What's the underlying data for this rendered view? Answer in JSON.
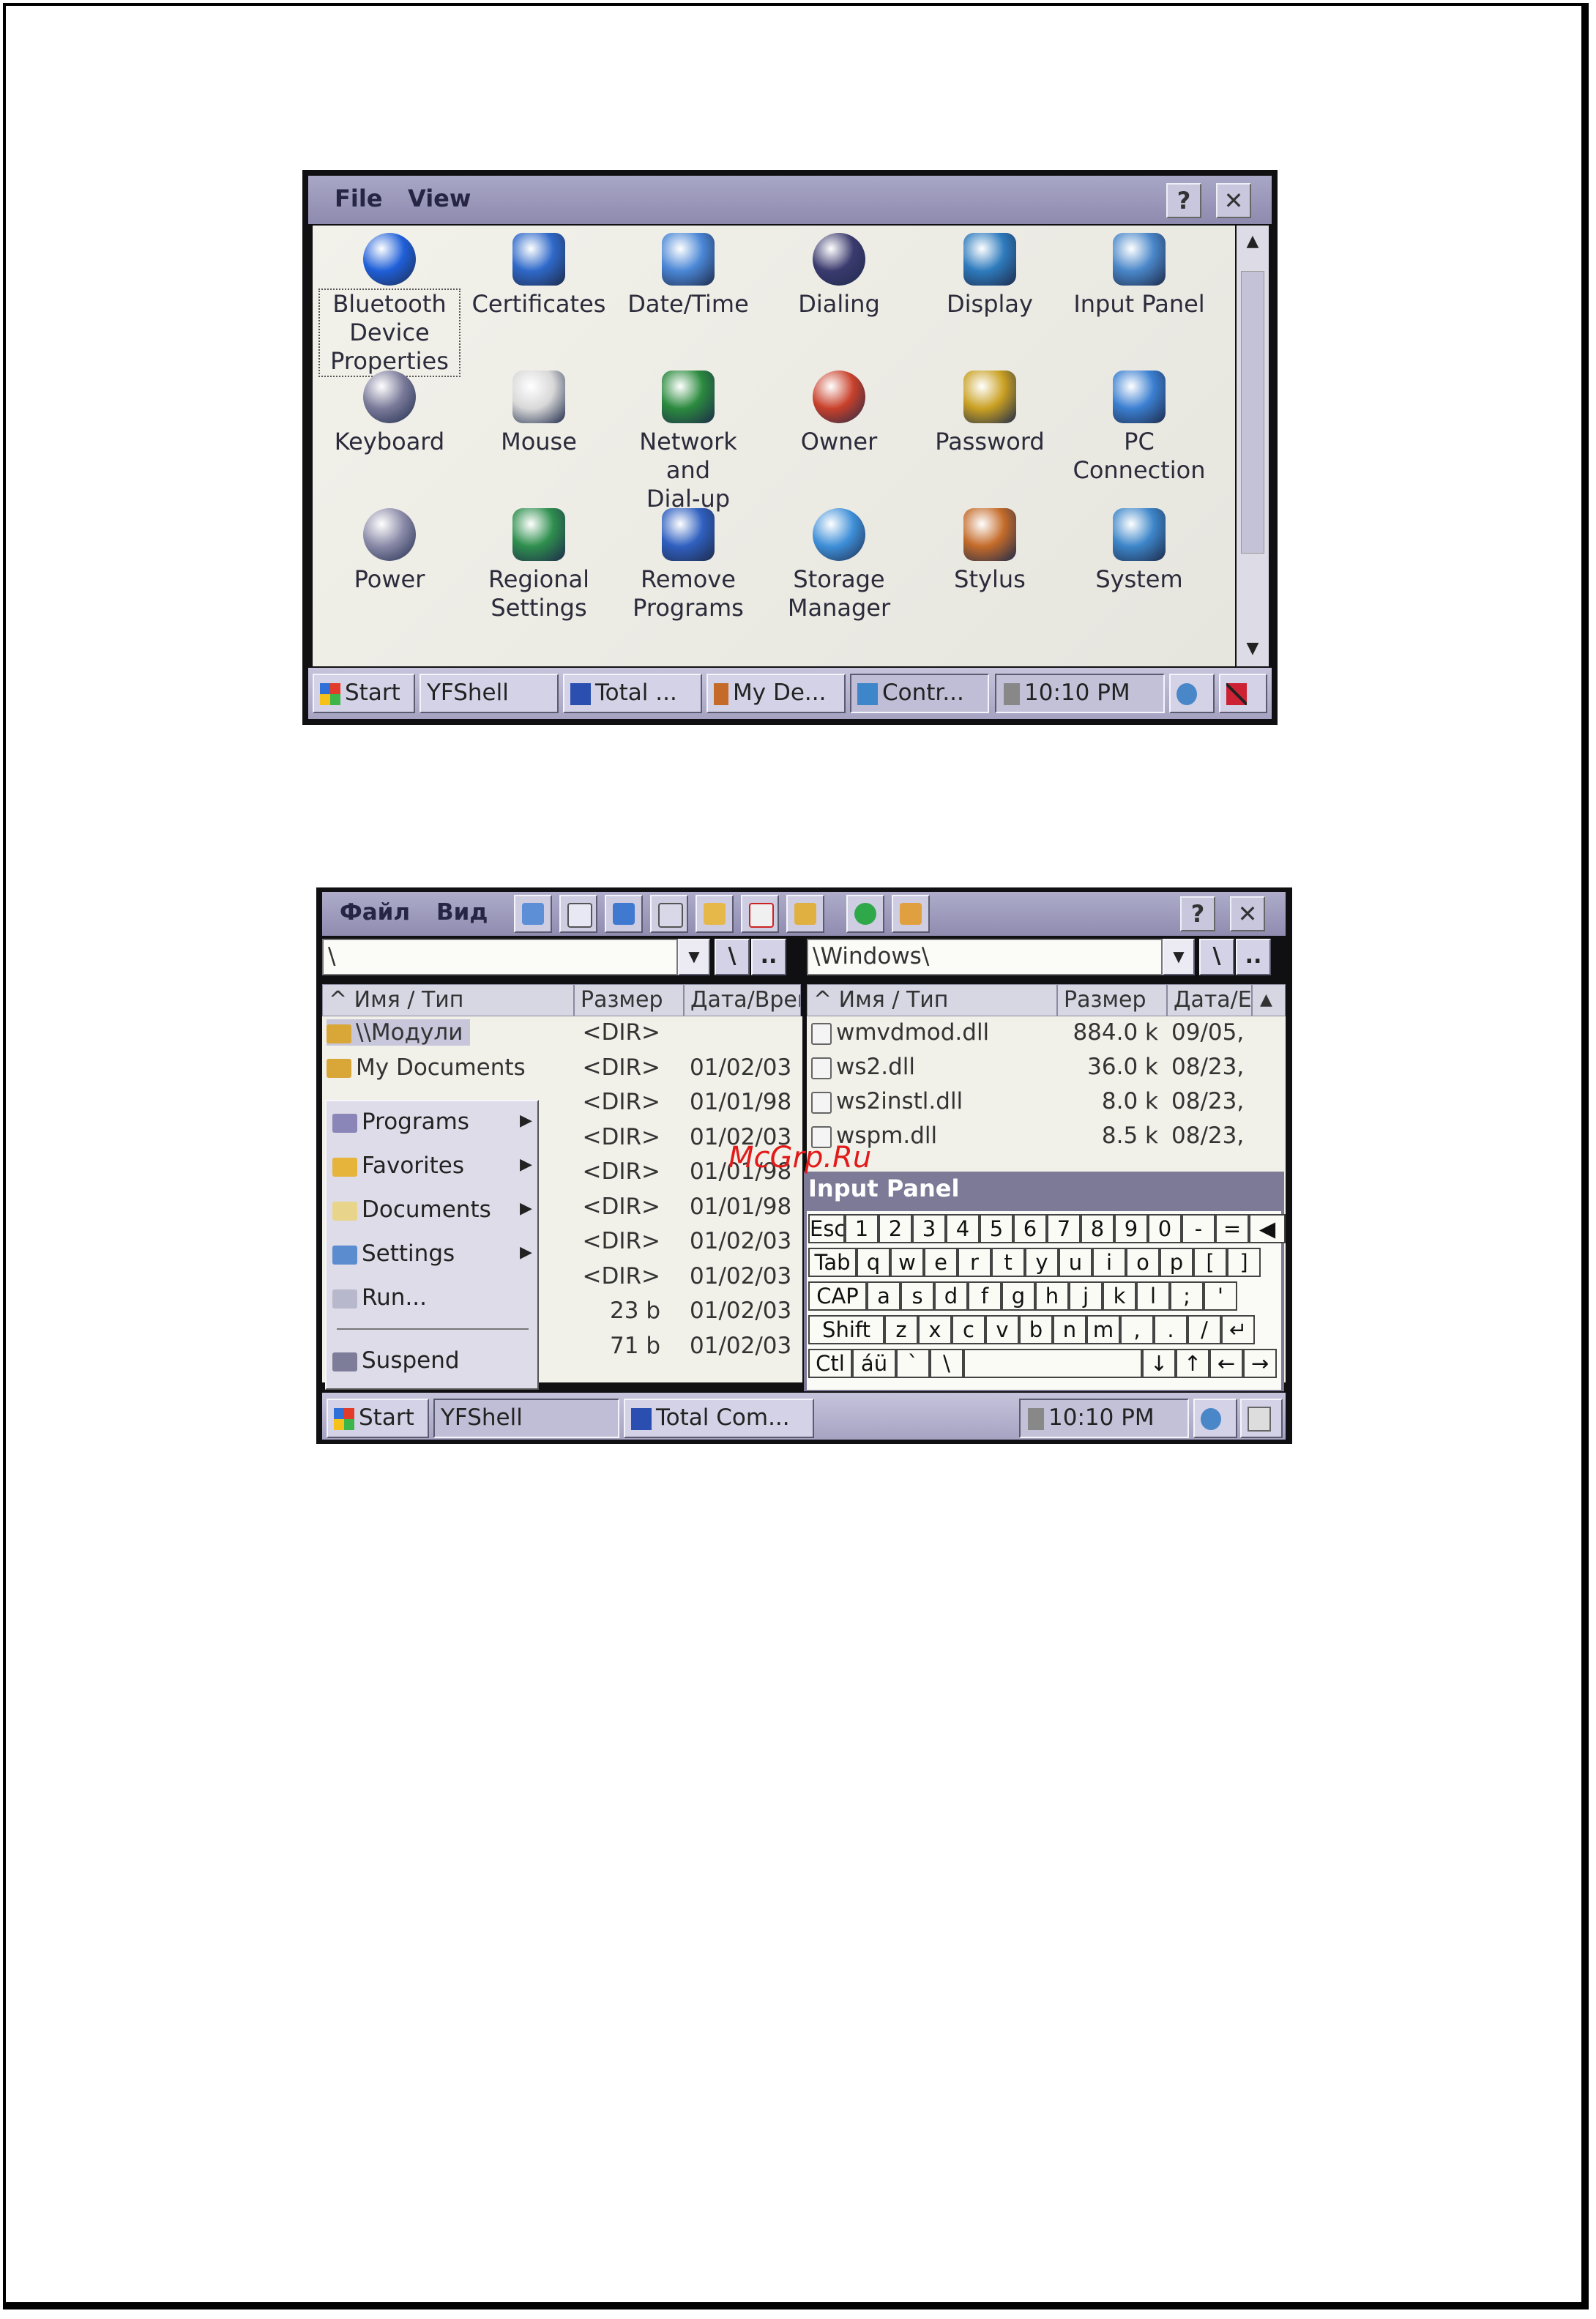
{
  "watermark": "McGrp.Ru",
  "screen1": {
    "menu": [
      "File",
      "View"
    ],
    "help_label": "?",
    "close_label": "✕",
    "icons": [
      {
        "label": "Bluetooth\nDevice\nProperties",
        "icon": "bluetooth-icon",
        "color": "#1f5fd8"
      },
      {
        "label": "Certificates",
        "icon": "gear-icon",
        "color": "#2f69c9"
      },
      {
        "label": "Date/Time",
        "icon": "clock-calendar-icon",
        "color": "#4b87d6"
      },
      {
        "label": "Dialing",
        "icon": "phone-icon",
        "color": "#3a3a6e"
      },
      {
        "label": "Display",
        "icon": "monitor-icon",
        "color": "#2e7bbd"
      },
      {
        "label": "Input Panel",
        "icon": "keyboard-monitor-icon",
        "color": "#4a87c9"
      },
      {
        "label": "Keyboard",
        "icon": "keyboard-icon",
        "color": "#7a7a9a"
      },
      {
        "label": "Mouse",
        "icon": "mouse-icon",
        "color": "#d8d8d8"
      },
      {
        "label": "Network and\nDial-up Co...",
        "icon": "globe-network-icon",
        "color": "#2b8a3e"
      },
      {
        "label": "Owner",
        "icon": "people-icon",
        "color": "#c8402a"
      },
      {
        "label": "Password",
        "icon": "padlock-icon",
        "color": "#c9a022"
      },
      {
        "label": "PC\nConnection",
        "icon": "pc-network-icon",
        "color": "#3b7fd1"
      },
      {
        "label": "Power",
        "icon": "power-plug-icon",
        "color": "#8a8aa8"
      },
      {
        "label": "Regional\nSettings",
        "icon": "globe-calendar-icon",
        "color": "#2f8f4e"
      },
      {
        "label": "Remove\nPrograms",
        "icon": "windows-box-icon",
        "color": "#3060c0"
      },
      {
        "label": "Storage\nManager",
        "icon": "pie-disk-icon",
        "color": "#3e8fd8"
      },
      {
        "label": "Stylus",
        "icon": "pda-icon",
        "color": "#c46b2a"
      },
      {
        "label": "System",
        "icon": "computer-icon",
        "color": "#3d86c9"
      }
    ],
    "taskbar": {
      "start": "Start",
      "items": [
        "YFShell",
        "Total ...",
        "My De...",
        "Contr..."
      ],
      "time": "10:10 PM"
    }
  },
  "screen2": {
    "menu": [
      "Файл",
      "Вид"
    ],
    "help_label": "?",
    "close_label": "✕",
    "left_panel": {
      "path": "\\",
      "root_btn": "\\",
      "up_btn": "..",
      "columns": [
        "^ Имя / Тип",
        "Размер",
        "Дата/Врем"
      ],
      "rows": [
        {
          "name": "\\\\Модули",
          "size": "<DIR>",
          "date": ""
        },
        {
          "name": "My Documents",
          "size": "<DIR>",
          "date": "01/02/03"
        },
        {
          "name": "",
          "size": "<DIR>",
          "date": "01/01/98"
        },
        {
          "name": "",
          "size": "<DIR>",
          "date": "01/02/03"
        },
        {
          "name": "",
          "size": "<DIR>",
          "date": "01/01/98"
        },
        {
          "name": "",
          "size": "<DIR>",
          "date": "01/01/98"
        },
        {
          "name": "",
          "size": "<DIR>",
          "date": "01/02/03"
        },
        {
          "name": "",
          "size": "<DIR>",
          "date": "01/02/03"
        },
        {
          "name": "",
          "size": "23 b",
          "date": "01/02/03"
        },
        {
          "name": "",
          "size": "71 b",
          "date": "01/02/03"
        }
      ]
    },
    "right_panel": {
      "path": "\\Windows\\",
      "root_btn": "\\",
      "up_btn": "..",
      "columns": [
        "^ Имя / Тип",
        "Размер",
        "Дата/Е"
      ],
      "rows": [
        {
          "name": "wmvdmod.dll",
          "size": "884.0 k",
          "date": "09/05,"
        },
        {
          "name": "ws2.dll",
          "size": "36.0 k",
          "date": "08/23,"
        },
        {
          "name": "ws2instl.dll",
          "size": "8.0 k",
          "date": "08/23,"
        },
        {
          "name": "wspm.dll",
          "size": "8.5 k",
          "date": "08/23,"
        }
      ]
    },
    "start_menu": [
      "Programs",
      "Favorites",
      "Documents",
      "Settings",
      "Run...",
      "Suspend"
    ],
    "input_panel": {
      "title": "Input Panel",
      "rows": [
        [
          "Esc",
          "1",
          "2",
          "3",
          "4",
          "5",
          "6",
          "7",
          "8",
          "9",
          "0",
          "-",
          "=",
          "◀"
        ],
        [
          "Tab",
          "q",
          "w",
          "e",
          "r",
          "t",
          "y",
          "u",
          "i",
          "o",
          "p",
          "[",
          "]"
        ],
        [
          "CAP",
          "a",
          "s",
          "d",
          "f",
          "g",
          "h",
          "j",
          "k",
          "l",
          ";",
          "'"
        ],
        [
          "Shift",
          "z",
          "x",
          "c",
          "v",
          "b",
          "n",
          "m",
          ",",
          ".",
          "/",
          "↵"
        ],
        [
          "Ctl",
          "áü",
          "`",
          "\\",
          "",
          "↓",
          "↑",
          "←",
          "→"
        ]
      ]
    },
    "taskbar": {
      "start": "Start",
      "items": [
        "YFShell",
        "Total Com..."
      ],
      "time": "10:10 PM"
    }
  }
}
